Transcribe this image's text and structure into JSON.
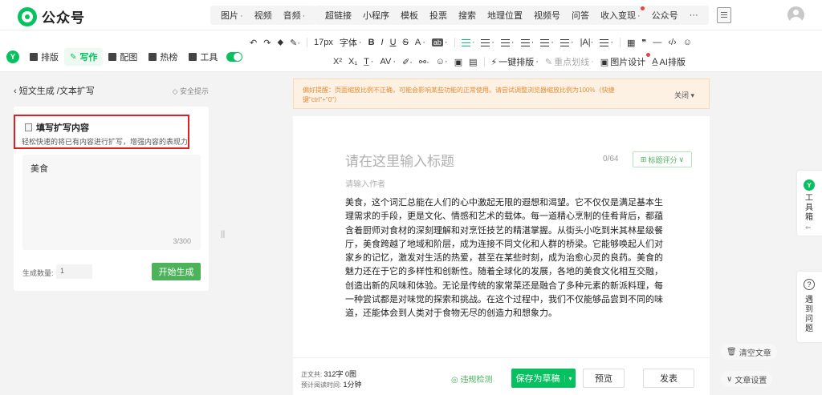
{
  "brand": {
    "name": "公众号",
    "accent": "#07c160"
  },
  "insert_menu": [
    {
      "label": "图片",
      "dropdown": true
    },
    {
      "label": "视频",
      "dropdown": false
    },
    {
      "label": "音频",
      "dropdown": true
    }
  ],
  "insert_menu2": [
    "超链接",
    "小程序",
    "模板",
    "投票",
    "搜索",
    "地理位置",
    "视频号",
    "问答"
  ],
  "monetize": "收入变现",
  "more_menu": [
    "公众号",
    "···"
  ],
  "side_tabs": {
    "layout": "排版",
    "write": "写作",
    "image": "配图",
    "hot": "热榜",
    "tools": "工具"
  },
  "format_row1": {
    "font_size": "17px",
    "font": "字体",
    "bold": "B",
    "italic": "I",
    "underline": "U",
    "strike": "S",
    "a_color": "A",
    "ab": "ab",
    "quote": "❞",
    "hr": "—",
    "code": "‹/›",
    "emoji": "☺"
  },
  "format_row2": {
    "sup": "X²",
    "sub": "X₁",
    "clear": "T̲",
    "spacing": "AV",
    "one_click": "一键排版",
    "highlight": "重点划线",
    "img_design": "图片设计",
    "ai_layout": "AI排版"
  },
  "panel": {
    "breadcrumb": "短文生成 /文本扩写",
    "safety": "安全提示",
    "card_title": "填写扩写内容",
    "card_desc": "轻松快速的将已有内容进行扩写，增强内容的表现力",
    "input_value": "美食",
    "input_count": "3/300",
    "gen_label": "生成数量:",
    "gen_value": "1",
    "gen_button": "开始生成"
  },
  "warning": {
    "text": "偏好提醒：页面缩放比例不正确，可能会影响某些功能的正常使用。请尝试调整浏览器缩放比例为100%（快捷键\"ctrl\"+\"0\"）",
    "close": "关闭"
  },
  "editor": {
    "title_placeholder": "请在这里输入标题",
    "title_count": "0/64",
    "score": "标题评分",
    "author_placeholder": "请输入作者",
    "body": "美食，这个词汇总能在人们的心中激起无限的遐想和渴望。它不仅仅是满足基本生理需求的手段，更是文化、情感和艺术的载体。每一道精心烹制的佳肴背后，都蕴含着厨师对食材的深刻理解和对烹饪技艺的精湛掌握。从街头小吃到米其林星级餐厅，美食跨越了地域和阶层，成为连接不同文化和人群的桥梁。它能够唤起人们对家乡的记忆，激发对生活的热爱，甚至在某些时刻，成为治愈心灵的良药。美食的魅力还在于它的多样性和创新性。随着全球化的发展，各地的美食文化相互交融，创造出新的风味和体验。无论是传统的家常菜还是融合了多种元素的新派料理，每一种尝试都是对味觉的探索和挑战。在这个过程中，我们不仅能够品尝到不同的味道，还能体会到人类对于食物无尽的创造力和想象力。"
  },
  "bottom": {
    "word_label": "正文共:",
    "word_value": "312字 0图",
    "read_label": "预计阅读时间:",
    "read_value": "1分钟",
    "check": "违规检测",
    "save": "保存为草稿",
    "preview": "预览",
    "publish": "发表"
  },
  "right": {
    "toolbox": "工具箱",
    "help": "遇到问题",
    "clear": "清空文章",
    "settings": "文章设置"
  }
}
